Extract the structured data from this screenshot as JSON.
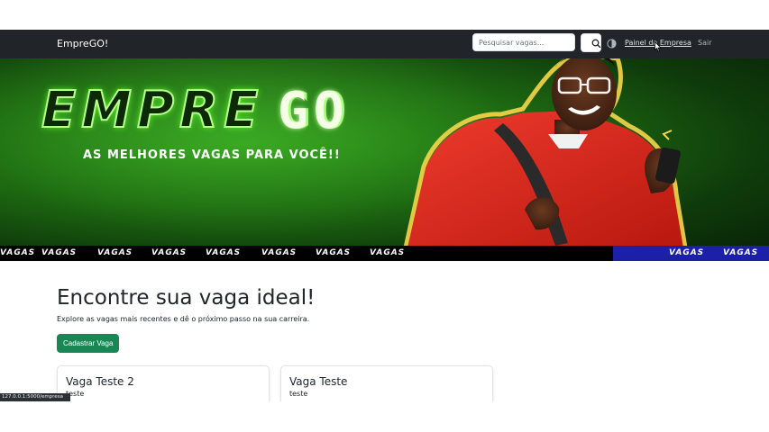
{
  "navbar": {
    "brand": "EmpreGO!",
    "search_placeholder": "Pesquisar vagas...",
    "search_icon": "search-icon",
    "theme_icon": "contrast-icon",
    "links": {
      "painel": "Painel da Empresa",
      "sair": "Sair"
    }
  },
  "hero": {
    "logo_text": "EMPREGO",
    "tagline": "AS MELHORES VAGAS PARA VOCÊ!!",
    "band_words": [
      "VAGAS",
      "VAGAS",
      "VAGAS",
      "VAGAS",
      "VAGAS",
      "VAGAS",
      "VAGAS",
      "VAGAS",
      "VAGAS",
      "VAGAS",
      "VAGAS",
      "VAGAS",
      "VAGAS",
      "VAGAS"
    ]
  },
  "main": {
    "heading": "Encontre sua vaga ideal!",
    "subtitle": "Explore as vagas mais recentes e dê o próximo passo na sua carreira.",
    "cta_label": "Cadastrar Vaga",
    "jobs": [
      {
        "title": "Vaga Teste 2",
        "description": "teste"
      },
      {
        "title": "Vaga Teste",
        "description": "teste"
      }
    ]
  },
  "status_url": "127.0.0.1:5000/empresa",
  "colors": {
    "navbar": "#212529",
    "accent_green": "#198754",
    "hero_green": "#1f6e12",
    "band_blue": "#1c1fa8"
  }
}
